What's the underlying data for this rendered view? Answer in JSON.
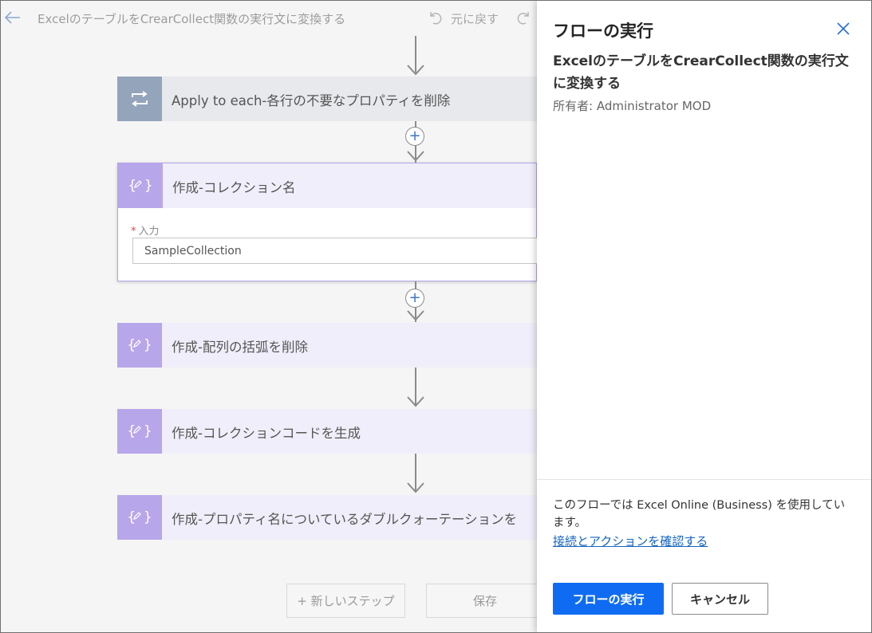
{
  "header": {
    "flow_title": "ExcelのテーブルをCrearCollect関数の実行文に変換する",
    "undo_label": "元に戻す"
  },
  "steps": [
    {
      "label": "Apply to each-各行の不要なプロパティを削除",
      "icon": "loop-icon"
    },
    {
      "label": "作成-コレクション名",
      "icon": "compose-icon",
      "field_label": "入力",
      "field_required": "*",
      "field_value": "SampleCollection"
    },
    {
      "label": "作成-配列の括弧を削除",
      "icon": "compose-icon"
    },
    {
      "label": "作成-コレクションコードを生成",
      "icon": "compose-icon"
    },
    {
      "label": "作成-プロパティ名についているダブルクォーテーションを",
      "icon": "compose-icon"
    }
  ],
  "bottom": {
    "new_step_label": "+ 新しいステップ",
    "save_label": "保存"
  },
  "panel": {
    "title": "フローの実行",
    "flow_name": "ExcelのテーブルをCrearCollect関数の実行文に変換する",
    "owner": "所有者: Administrator MOD",
    "note": "このフローでは Excel Online (Business) を使用しています。",
    "link": "接続とアクションを確認する",
    "run_label": "フローの実行",
    "cancel_label": "キャンセル"
  },
  "colors": {
    "accent_blue": "#0f6cf2",
    "loop_tile": "#93a4bb",
    "compose_tile": "#b8a6ea",
    "link": "#1565c0"
  }
}
